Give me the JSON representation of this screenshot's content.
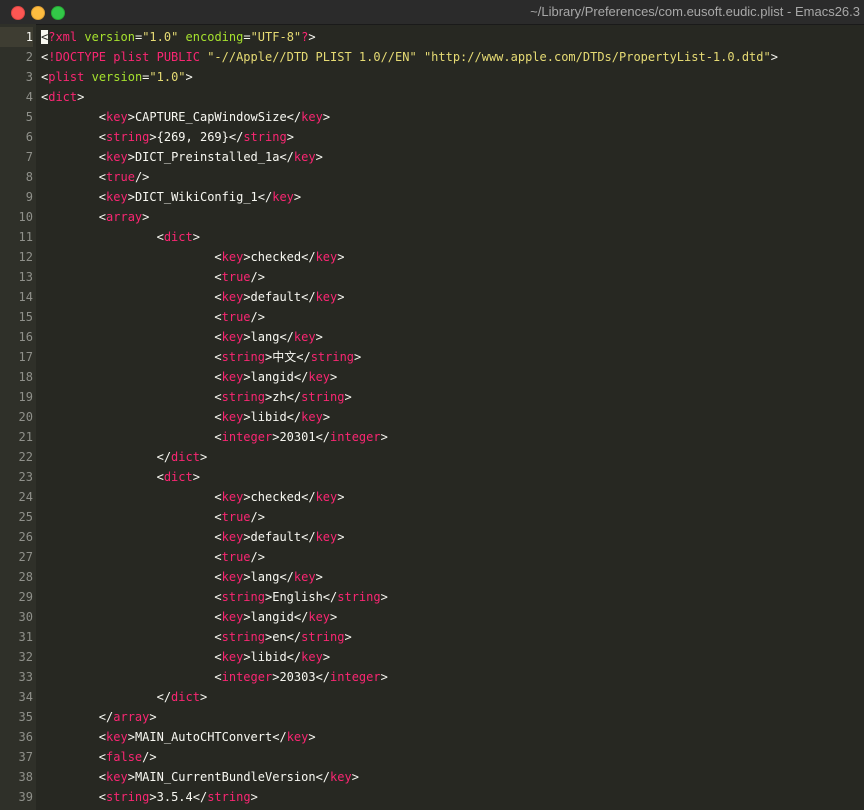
{
  "window": {
    "title": "~/Library/Preferences/com.eusoft.eudic.plist - Emacs26.3"
  },
  "colors": {
    "background": "#272822",
    "tag": "#f92672",
    "attribute": "#a6e22e",
    "string": "#e6db74",
    "text": "#f8f8f2",
    "line_number": "#8f908a"
  },
  "editor": {
    "current_line": 1,
    "lines": [
      {
        "n": "1",
        "t": [
          [
            "cursor",
            "<"
          ],
          [
            "tag",
            "?xml"
          ],
          [
            "txt",
            " "
          ],
          [
            "attr",
            "version"
          ],
          [
            "txt",
            "="
          ],
          [
            "str",
            "\"1.0\""
          ],
          [
            "txt",
            " "
          ],
          [
            "attr",
            "encoding"
          ],
          [
            "txt",
            "="
          ],
          [
            "str",
            "\"UTF-8\""
          ],
          [
            "tag",
            "?"
          ],
          [
            "br",
            ">"
          ]
        ]
      },
      {
        "n": "2",
        "t": [
          [
            "br",
            "<"
          ],
          [
            "tag",
            "!DOCTYPE plist PUBLIC"
          ],
          [
            "txt",
            " "
          ],
          [
            "str",
            "\"-//Apple//DTD PLIST 1.0//EN\""
          ],
          [
            "txt",
            " "
          ],
          [
            "str",
            "\"http://www.apple.com/DTDs/PropertyList-1.0.dtd\""
          ],
          [
            "br",
            ">"
          ]
        ]
      },
      {
        "n": "3",
        "t": [
          [
            "br",
            "<"
          ],
          [
            "tag",
            "plist"
          ],
          [
            "txt",
            " "
          ],
          [
            "attr",
            "version"
          ],
          [
            "txt",
            "="
          ],
          [
            "str",
            "\"1.0\""
          ],
          [
            "br",
            ">"
          ]
        ]
      },
      {
        "n": "4",
        "t": [
          [
            "br",
            "<"
          ],
          [
            "tag",
            "dict"
          ],
          [
            "br",
            ">"
          ]
        ]
      },
      {
        "n": "5",
        "t": [
          [
            "txt",
            "        "
          ],
          [
            "br",
            "<"
          ],
          [
            "tag",
            "key"
          ],
          [
            "br",
            ">"
          ],
          [
            "txt",
            "CAPTURE_CapWindowSize"
          ],
          [
            "br",
            "</"
          ],
          [
            "tag",
            "key"
          ],
          [
            "br",
            ">"
          ]
        ]
      },
      {
        "n": "6",
        "t": [
          [
            "txt",
            "        "
          ],
          [
            "br",
            "<"
          ],
          [
            "tag",
            "string"
          ],
          [
            "br",
            ">"
          ],
          [
            "txt",
            "{269, 269}"
          ],
          [
            "br",
            "</"
          ],
          [
            "tag",
            "string"
          ],
          [
            "br",
            ">"
          ]
        ]
      },
      {
        "n": "7",
        "t": [
          [
            "txt",
            "        "
          ],
          [
            "br",
            "<"
          ],
          [
            "tag",
            "key"
          ],
          [
            "br",
            ">"
          ],
          [
            "txt",
            "DICT_Preinstalled_1a"
          ],
          [
            "br",
            "</"
          ],
          [
            "tag",
            "key"
          ],
          [
            "br",
            ">"
          ]
        ]
      },
      {
        "n": "8",
        "t": [
          [
            "txt",
            "        "
          ],
          [
            "br",
            "<"
          ],
          [
            "tag",
            "true"
          ],
          [
            "br",
            "/>"
          ]
        ]
      },
      {
        "n": "9",
        "t": [
          [
            "txt",
            "        "
          ],
          [
            "br",
            "<"
          ],
          [
            "tag",
            "key"
          ],
          [
            "br",
            ">"
          ],
          [
            "txt",
            "DICT_WikiConfig_1"
          ],
          [
            "br",
            "</"
          ],
          [
            "tag",
            "key"
          ],
          [
            "br",
            ">"
          ]
        ]
      },
      {
        "n": "10",
        "t": [
          [
            "txt",
            "        "
          ],
          [
            "br",
            "<"
          ],
          [
            "tag",
            "array"
          ],
          [
            "br",
            ">"
          ]
        ]
      },
      {
        "n": "11",
        "t": [
          [
            "txt",
            "                "
          ],
          [
            "br",
            "<"
          ],
          [
            "tag",
            "dict"
          ],
          [
            "br",
            ">"
          ]
        ]
      },
      {
        "n": "12",
        "t": [
          [
            "txt",
            "                        "
          ],
          [
            "br",
            "<"
          ],
          [
            "tag",
            "key"
          ],
          [
            "br",
            ">"
          ],
          [
            "txt",
            "checked"
          ],
          [
            "br",
            "</"
          ],
          [
            "tag",
            "key"
          ],
          [
            "br",
            ">"
          ]
        ]
      },
      {
        "n": "13",
        "t": [
          [
            "txt",
            "                        "
          ],
          [
            "br",
            "<"
          ],
          [
            "tag",
            "true"
          ],
          [
            "br",
            "/>"
          ]
        ]
      },
      {
        "n": "14",
        "t": [
          [
            "txt",
            "                        "
          ],
          [
            "br",
            "<"
          ],
          [
            "tag",
            "key"
          ],
          [
            "br",
            ">"
          ],
          [
            "txt",
            "default"
          ],
          [
            "br",
            "</"
          ],
          [
            "tag",
            "key"
          ],
          [
            "br",
            ">"
          ]
        ]
      },
      {
        "n": "15",
        "t": [
          [
            "txt",
            "                        "
          ],
          [
            "br",
            "<"
          ],
          [
            "tag",
            "true"
          ],
          [
            "br",
            "/>"
          ]
        ]
      },
      {
        "n": "16",
        "t": [
          [
            "txt",
            "                        "
          ],
          [
            "br",
            "<"
          ],
          [
            "tag",
            "key"
          ],
          [
            "br",
            ">"
          ],
          [
            "txt",
            "lang"
          ],
          [
            "br",
            "</"
          ],
          [
            "tag",
            "key"
          ],
          [
            "br",
            ">"
          ]
        ]
      },
      {
        "n": "17",
        "t": [
          [
            "txt",
            "                        "
          ],
          [
            "br",
            "<"
          ],
          [
            "tag",
            "string"
          ],
          [
            "br",
            ">"
          ],
          [
            "txt",
            "中文"
          ],
          [
            "br",
            "</"
          ],
          [
            "tag",
            "string"
          ],
          [
            "br",
            ">"
          ]
        ]
      },
      {
        "n": "18",
        "t": [
          [
            "txt",
            "                        "
          ],
          [
            "br",
            "<"
          ],
          [
            "tag",
            "key"
          ],
          [
            "br",
            ">"
          ],
          [
            "txt",
            "langid"
          ],
          [
            "br",
            "</"
          ],
          [
            "tag",
            "key"
          ],
          [
            "br",
            ">"
          ]
        ]
      },
      {
        "n": "19",
        "t": [
          [
            "txt",
            "                        "
          ],
          [
            "br",
            "<"
          ],
          [
            "tag",
            "string"
          ],
          [
            "br",
            ">"
          ],
          [
            "txt",
            "zh"
          ],
          [
            "br",
            "</"
          ],
          [
            "tag",
            "string"
          ],
          [
            "br",
            ">"
          ]
        ]
      },
      {
        "n": "20",
        "t": [
          [
            "txt",
            "                        "
          ],
          [
            "br",
            "<"
          ],
          [
            "tag",
            "key"
          ],
          [
            "br",
            ">"
          ],
          [
            "txt",
            "libid"
          ],
          [
            "br",
            "</"
          ],
          [
            "tag",
            "key"
          ],
          [
            "br",
            ">"
          ]
        ]
      },
      {
        "n": "21",
        "t": [
          [
            "txt",
            "                        "
          ],
          [
            "br",
            "<"
          ],
          [
            "tag",
            "integer"
          ],
          [
            "br",
            ">"
          ],
          [
            "txt",
            "20301"
          ],
          [
            "br",
            "</"
          ],
          [
            "tag",
            "integer"
          ],
          [
            "br",
            ">"
          ]
        ]
      },
      {
        "n": "22",
        "t": [
          [
            "txt",
            "                "
          ],
          [
            "br",
            "</"
          ],
          [
            "tag",
            "dict"
          ],
          [
            "br",
            ">"
          ]
        ]
      },
      {
        "n": "23",
        "t": [
          [
            "txt",
            "                "
          ],
          [
            "br",
            "<"
          ],
          [
            "tag",
            "dict"
          ],
          [
            "br",
            ">"
          ]
        ]
      },
      {
        "n": "24",
        "t": [
          [
            "txt",
            "                        "
          ],
          [
            "br",
            "<"
          ],
          [
            "tag",
            "key"
          ],
          [
            "br",
            ">"
          ],
          [
            "txt",
            "checked"
          ],
          [
            "br",
            "</"
          ],
          [
            "tag",
            "key"
          ],
          [
            "br",
            ">"
          ]
        ]
      },
      {
        "n": "25",
        "t": [
          [
            "txt",
            "                        "
          ],
          [
            "br",
            "<"
          ],
          [
            "tag",
            "true"
          ],
          [
            "br",
            "/>"
          ]
        ]
      },
      {
        "n": "26",
        "t": [
          [
            "txt",
            "                        "
          ],
          [
            "br",
            "<"
          ],
          [
            "tag",
            "key"
          ],
          [
            "br",
            ">"
          ],
          [
            "txt",
            "default"
          ],
          [
            "br",
            "</"
          ],
          [
            "tag",
            "key"
          ],
          [
            "br",
            ">"
          ]
        ]
      },
      {
        "n": "27",
        "t": [
          [
            "txt",
            "                        "
          ],
          [
            "br",
            "<"
          ],
          [
            "tag",
            "true"
          ],
          [
            "br",
            "/>"
          ]
        ]
      },
      {
        "n": "28",
        "t": [
          [
            "txt",
            "                        "
          ],
          [
            "br",
            "<"
          ],
          [
            "tag",
            "key"
          ],
          [
            "br",
            ">"
          ],
          [
            "txt",
            "lang"
          ],
          [
            "br",
            "</"
          ],
          [
            "tag",
            "key"
          ],
          [
            "br",
            ">"
          ]
        ]
      },
      {
        "n": "29",
        "t": [
          [
            "txt",
            "                        "
          ],
          [
            "br",
            "<"
          ],
          [
            "tag",
            "string"
          ],
          [
            "br",
            ">"
          ],
          [
            "txt",
            "English"
          ],
          [
            "br",
            "</"
          ],
          [
            "tag",
            "string"
          ],
          [
            "br",
            ">"
          ]
        ]
      },
      {
        "n": "30",
        "t": [
          [
            "txt",
            "                        "
          ],
          [
            "br",
            "<"
          ],
          [
            "tag",
            "key"
          ],
          [
            "br",
            ">"
          ],
          [
            "txt",
            "langid"
          ],
          [
            "br",
            "</"
          ],
          [
            "tag",
            "key"
          ],
          [
            "br",
            ">"
          ]
        ]
      },
      {
        "n": "31",
        "t": [
          [
            "txt",
            "                        "
          ],
          [
            "br",
            "<"
          ],
          [
            "tag",
            "string"
          ],
          [
            "br",
            ">"
          ],
          [
            "txt",
            "en"
          ],
          [
            "br",
            "</"
          ],
          [
            "tag",
            "string"
          ],
          [
            "br",
            ">"
          ]
        ]
      },
      {
        "n": "32",
        "t": [
          [
            "txt",
            "                        "
          ],
          [
            "br",
            "<"
          ],
          [
            "tag",
            "key"
          ],
          [
            "br",
            ">"
          ],
          [
            "txt",
            "libid"
          ],
          [
            "br",
            "</"
          ],
          [
            "tag",
            "key"
          ],
          [
            "br",
            ">"
          ]
        ]
      },
      {
        "n": "33",
        "t": [
          [
            "txt",
            "                        "
          ],
          [
            "br",
            "<"
          ],
          [
            "tag",
            "integer"
          ],
          [
            "br",
            ">"
          ],
          [
            "txt",
            "20303"
          ],
          [
            "br",
            "</"
          ],
          [
            "tag",
            "integer"
          ],
          [
            "br",
            ">"
          ]
        ]
      },
      {
        "n": "34",
        "t": [
          [
            "txt",
            "                "
          ],
          [
            "br",
            "</"
          ],
          [
            "tag",
            "dict"
          ],
          [
            "br",
            ">"
          ]
        ]
      },
      {
        "n": "35",
        "t": [
          [
            "txt",
            "        "
          ],
          [
            "br",
            "</"
          ],
          [
            "tag",
            "array"
          ],
          [
            "br",
            ">"
          ]
        ]
      },
      {
        "n": "36",
        "t": [
          [
            "txt",
            "        "
          ],
          [
            "br",
            "<"
          ],
          [
            "tag",
            "key"
          ],
          [
            "br",
            ">"
          ],
          [
            "txt",
            "MAIN_AutoCHTConvert"
          ],
          [
            "br",
            "</"
          ],
          [
            "tag",
            "key"
          ],
          [
            "br",
            ">"
          ]
        ]
      },
      {
        "n": "37",
        "t": [
          [
            "txt",
            "        "
          ],
          [
            "br",
            "<"
          ],
          [
            "tag",
            "false"
          ],
          [
            "br",
            "/>"
          ]
        ]
      },
      {
        "n": "38",
        "t": [
          [
            "txt",
            "        "
          ],
          [
            "br",
            "<"
          ],
          [
            "tag",
            "key"
          ],
          [
            "br",
            ">"
          ],
          [
            "txt",
            "MAIN_CurrentBundleVersion"
          ],
          [
            "br",
            "</"
          ],
          [
            "tag",
            "key"
          ],
          [
            "br",
            ">"
          ]
        ]
      },
      {
        "n": "39",
        "t": [
          [
            "txt",
            "        "
          ],
          [
            "br",
            "<"
          ],
          [
            "tag",
            "string"
          ],
          [
            "br",
            ">"
          ],
          [
            "txt",
            "3.5.4"
          ],
          [
            "br",
            "</"
          ],
          [
            "tag",
            "string"
          ],
          [
            "br",
            ">"
          ]
        ]
      }
    ]
  }
}
